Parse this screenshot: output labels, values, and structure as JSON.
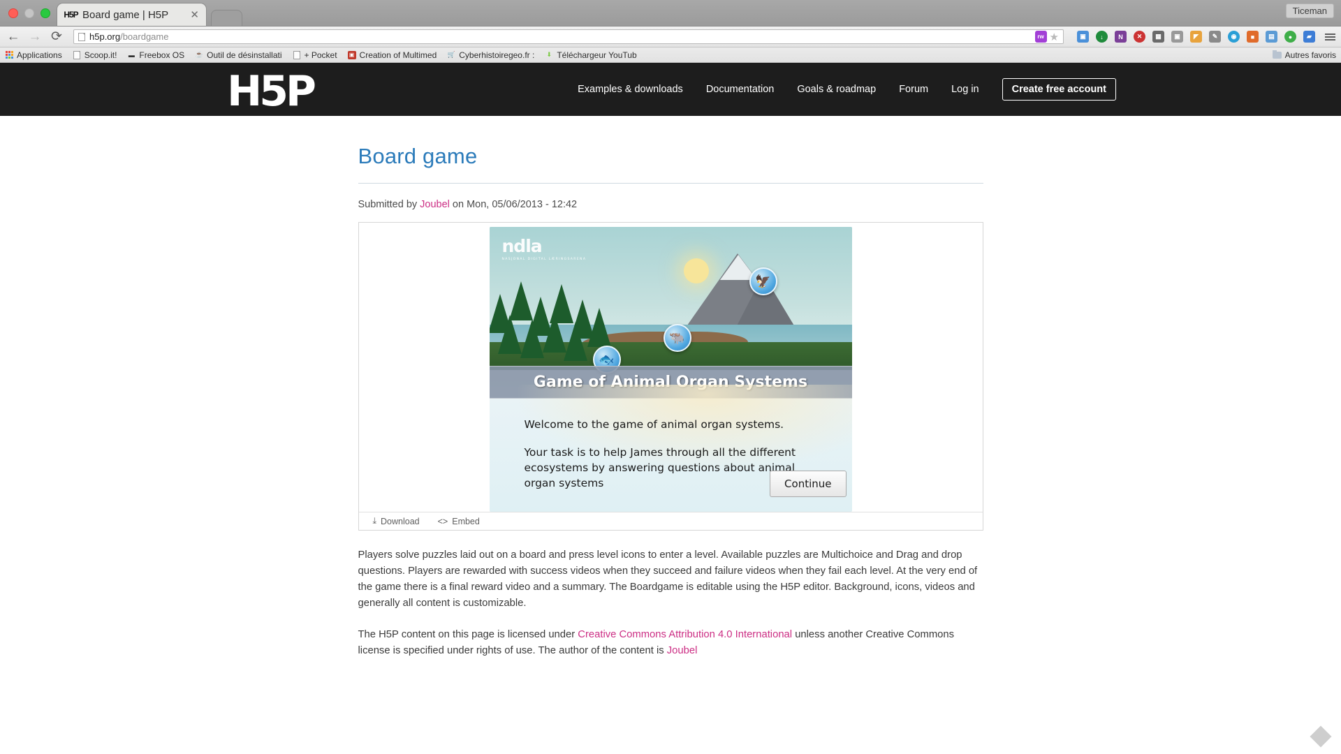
{
  "browser": {
    "window_user": "Ticeman",
    "tab": {
      "favicon": "h5p-favicon",
      "title": "Board game | H5P",
      "close": "✕"
    },
    "nav": {
      "back": "←",
      "forward": "→",
      "reload": "⟳"
    },
    "omnibox": {
      "url_bold": "h5p.org",
      "url_rest": "/boardgame",
      "full_url": "h5p.org/boardgame",
      "extension_badge": "rw",
      "bookmark_star": "★"
    },
    "extensions": [
      {
        "name": "colored-squares-icon",
        "label": "",
        "color": "#4a90d9"
      },
      {
        "name": "download-circle-icon",
        "label": "↓",
        "color": "#1f8b3c"
      },
      {
        "name": "onenote-icon",
        "label": "N",
        "color": "#7b3f98"
      },
      {
        "name": "red-x-icon",
        "label": "✕",
        "color": "#cc3333"
      },
      {
        "name": "grid-icon",
        "label": "▦",
        "color": "#6b6b6b"
      },
      {
        "name": "camera-icon",
        "label": "▣",
        "color": "#999999"
      },
      {
        "name": "bookmark-tag-icon",
        "label": "◤",
        "color": "#e8a33d"
      },
      {
        "name": "pencil-icon",
        "label": "✎",
        "color": "#8a8a8a"
      },
      {
        "name": "globe-icon",
        "label": "◉",
        "color": "#2a9fd6"
      },
      {
        "name": "orange-box-icon",
        "label": "■",
        "color": "#e06b2b"
      },
      {
        "name": "window-icon",
        "label": "▤",
        "color": "#5b9bd5"
      },
      {
        "name": "green-circle-icon",
        "label": "●",
        "color": "#3fae49"
      },
      {
        "name": "blue-chat-icon",
        "label": "▰",
        "color": "#3d7dd6"
      },
      {
        "name": "menu-icon",
        "label": "≡",
        "color": "#5d5d5d"
      }
    ],
    "bookmarks": [
      {
        "label": "Applications",
        "icon": "apps-grid-icon"
      },
      {
        "label": "Scoop.it!",
        "icon": "document-icon"
      },
      {
        "label": "Freebox OS",
        "icon": "freebox-icon"
      },
      {
        "label": "Outil de désinstallati",
        "icon": "java-icon"
      },
      {
        "label": "+ Pocket",
        "icon": "document-icon"
      },
      {
        "label": "Creation of Multimed",
        "icon": "multimedia-icon"
      },
      {
        "label": "Cyberhistoiregeo.fr :",
        "icon": "cart-icon"
      },
      {
        "label": "Téléchargeur YouTub",
        "icon": "download-green-icon"
      }
    ],
    "other_bookmarks": {
      "label": "Autres favoris",
      "icon": "folder-icon"
    }
  },
  "site": {
    "logo": "H5P",
    "nav": [
      {
        "label": "Examples & downloads"
      },
      {
        "label": "Documentation"
      },
      {
        "label": "Goals & roadmap"
      },
      {
        "label": "Forum"
      },
      {
        "label": "Log in"
      }
    ],
    "cta": "Create free account",
    "page_title": "Board game",
    "submitted": {
      "prefix": "Submitted by ",
      "author": "Joubel",
      "suffix": " on Mon, 05/06/2013 - 12:42"
    },
    "game": {
      "brand": "ndla",
      "brand_sub": "NASJONAL DIGITAL LÆRINGSARENA",
      "title": "Game of Animal Organ Systems",
      "intro_1": "Welcome to the game of animal organ systems.",
      "intro_2": "Your task is to help James through all the different ecosystems by answering questions about animal organ systems",
      "continue": "Continue",
      "pins": [
        "🦅",
        "🐃",
        "🐟"
      ]
    },
    "actions": [
      {
        "label": "Download",
        "icon": "download-icon",
        "glyph": "⤓"
      },
      {
        "label": "Embed",
        "icon": "code-icon",
        "glyph": "<>"
      }
    ],
    "description": "Players solve puzzles laid out on a board and press level icons to enter a level. Available puzzles are Multichoice and Drag and drop questions. Players are rewarded with success videos when they succeed and failure videos when they fail each level. At the very end of the game there is a final reward video and a summary. The Boardgame is editable using the H5P editor. Background, icons, videos and generally all content is customizable.",
    "license": {
      "prefix": "The H5P content on this page is licensed under ",
      "link": "Creative Commons Attribution 4.0 International",
      "middle": " unless another Creative Commons license is specified under rights of use. The author of the content is ",
      "author": "Joubel"
    }
  },
  "colors": {
    "accent_blue": "#2b7bba",
    "pink_link": "#cc2e84",
    "header_bg": "#1d1d1d"
  }
}
